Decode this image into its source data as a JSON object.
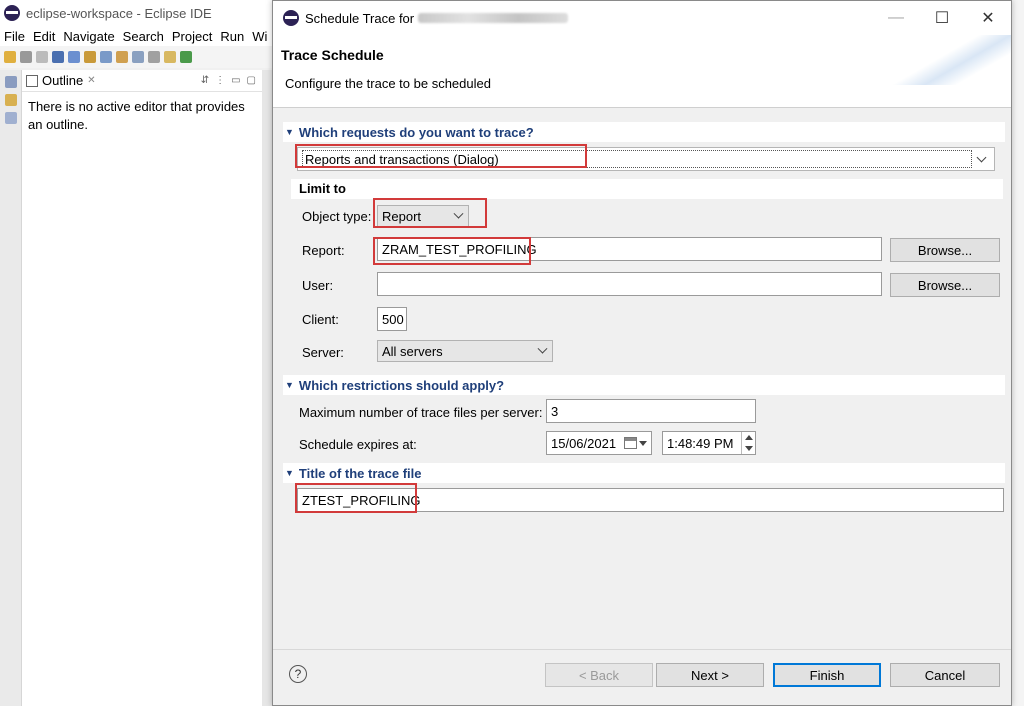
{
  "eclipse": {
    "title": "eclipse-workspace - Eclipse IDE",
    "menu": [
      "File",
      "Edit",
      "Navigate",
      "Search",
      "Project",
      "Run",
      "Wi"
    ],
    "outline": {
      "tab_label": "Outline",
      "message": "There is no active editor that provides an outline."
    }
  },
  "dialog": {
    "window_title": "Schedule Trace for",
    "banner_heading": "Trace Schedule",
    "banner_description": "Configure the trace to be scheduled",
    "section_requests": {
      "title": "Which requests do you want to trace?",
      "selected_request": "Reports and transactions (Dialog)"
    },
    "limit_to": {
      "title": "Limit to",
      "object_type_label": "Object type:",
      "object_type_value": "Report",
      "report_label": "Report:",
      "report_value": "ZRAM_TEST_PROFILING",
      "user_label": "User:",
      "user_value": "",
      "client_label": "Client:",
      "client_value": "500",
      "server_label": "Server:",
      "server_value": "All servers",
      "browse_label": "Browse..."
    },
    "section_restrictions": {
      "title": "Which restrictions should apply?",
      "max_files_label": "Maximum number of trace files per server:",
      "max_files_value": "3",
      "expires_label": "Schedule expires at:",
      "expires_date": "15/06/2021",
      "expires_time": "1:48:49 PM"
    },
    "section_title": {
      "title": "Title of the trace file",
      "value": "ZTEST_PROFILING"
    },
    "buttons": {
      "back": "< Back",
      "next": "Next >",
      "finish": "Finish",
      "cancel": "Cancel",
      "help": "?"
    }
  },
  "colors": {
    "section_header_text": "#1f3f7a",
    "highlight": "#d23a3a",
    "default_button_border": "#0078d7"
  },
  "icons": [
    "eclipse-logo-icon",
    "help-icon",
    "calendar-icon",
    "chevron-down-icon",
    "close-icon",
    "maximize-icon",
    "minimize-icon"
  ]
}
